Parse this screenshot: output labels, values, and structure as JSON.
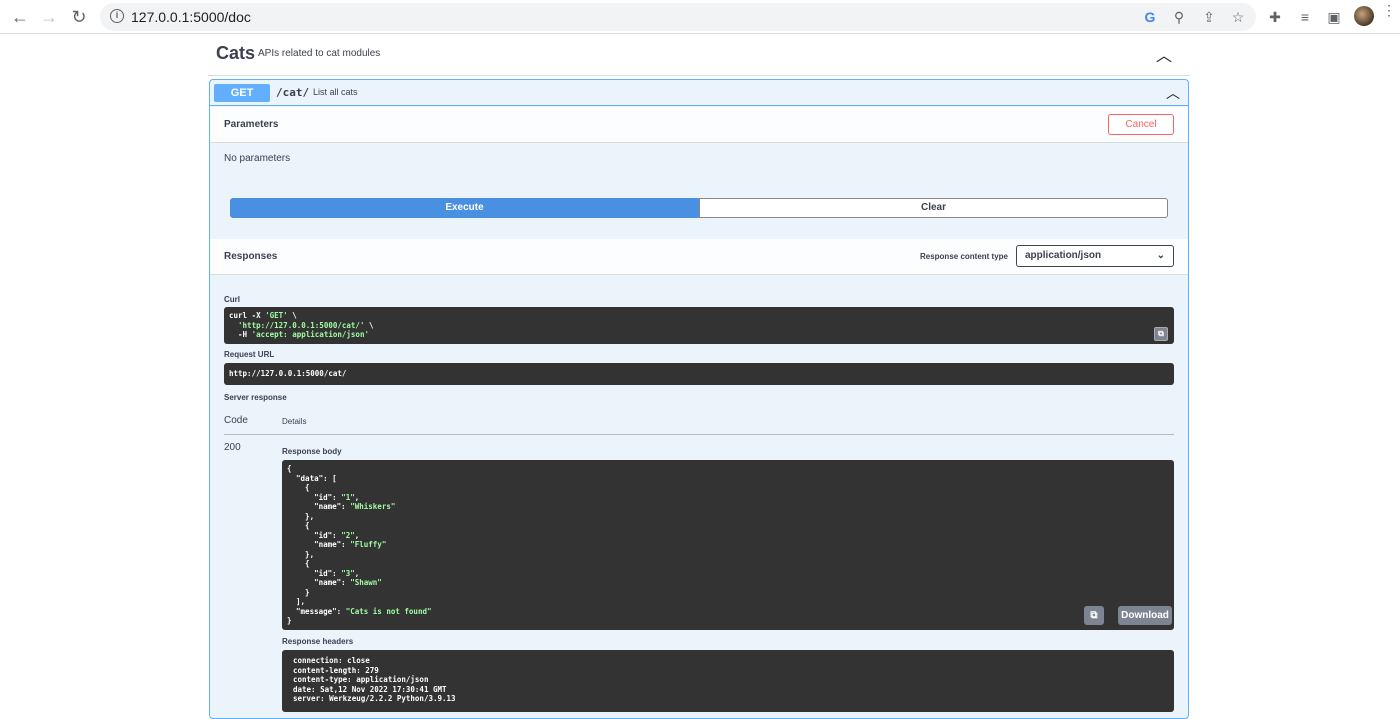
{
  "browser": {
    "url": "127.0.0.1:5000/doc",
    "back_icon": "←",
    "forward_icon": "→",
    "reload_icon": "↻"
  },
  "tag": {
    "name": "Cats",
    "description": "APIs related to cat modules"
  },
  "operation": {
    "method": "GET",
    "path": "/cat/",
    "summary": "List all cats"
  },
  "parameters": {
    "title": "Parameters",
    "cancel_label": "Cancel",
    "empty_text": "No parameters"
  },
  "actions": {
    "execute_label": "Execute",
    "clear_label": "Clear"
  },
  "responses": {
    "title": "Responses",
    "content_type_label": "Response content type",
    "content_type_value": "application/json",
    "curl_label": "Curl",
    "curl_line1_prefix": "curl -X ",
    "curl_line1_str": "'GET'",
    "curl_line1_suffix": " \\",
    "curl_line2_str": "'http://127.0.0.1:5000/cat/'",
    "curl_line2_suffix": " \\",
    "curl_line3_prefix": "-H ",
    "curl_line3_str": "'accept: application/json'",
    "request_url_label": "Request URL",
    "request_url": "http://127.0.0.1:5000/cat/",
    "server_response_label": "Server response",
    "code_header": "Code",
    "details_header": "Details",
    "status_code": "200",
    "response_body_label": "Response body",
    "body": {
      "data_key": "\"data\"",
      "items": [
        {
          "id": "\"1\"",
          "name": "\"Whiskers\""
        },
        {
          "id": "\"2\"",
          "name": "\"Fluffy\""
        },
        {
          "id": "\"3\"",
          "name": "\"Shawn\""
        }
      ],
      "message_key": "\"message\"",
      "message_value": "\"Cats is not found\""
    },
    "download_label": "Download",
    "response_headers_label": "Response headers",
    "headers": [
      "connection: close",
      "content-length: 279",
      "content-type: application/json",
      "date: Sat,12 Nov 2022 17:30:41 GMT",
      "server: Werkzeug/2.2.2 Python/3.9.13"
    ]
  }
}
